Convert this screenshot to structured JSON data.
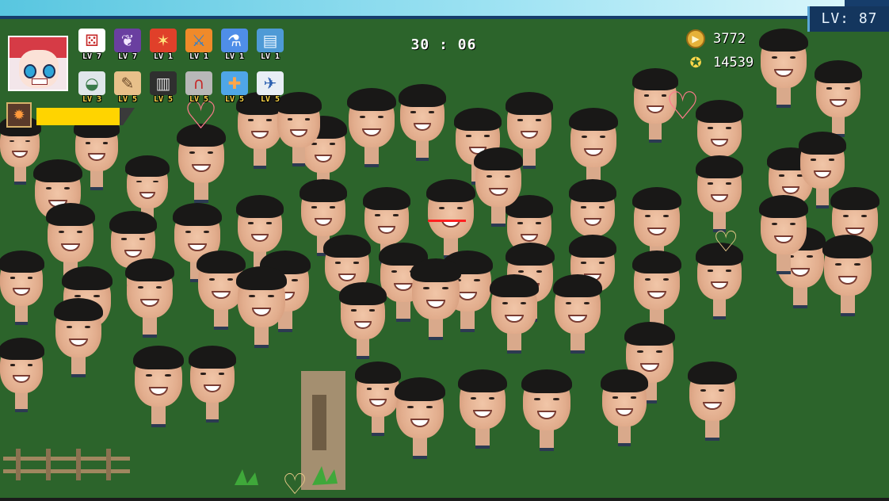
{
  "hud": {
    "level": "LV: 87",
    "experience_fraction": 0.95,
    "timer": "30 : 06",
    "gold": "3772",
    "kills": "14539",
    "special_charge_fraction": 0.85
  },
  "weapons": [
    {
      "icon": "dice-icon",
      "glyph": "⚄",
      "bg": "#ffffff",
      "color": "#c62828",
      "level": "LV 7"
    },
    {
      "icon": "grapes-icon",
      "glyph": "❦",
      "bg": "#6a3fa0",
      "color": "#f2e6ff",
      "level": "LV 7"
    },
    {
      "icon": "fire-slash-icon",
      "glyph": "✶",
      "bg": "#e0402a",
      "color": "#ffe27a",
      "level": "LV 1"
    },
    {
      "icon": "crossed-swords-icon",
      "glyph": "⚔",
      "bg": "#f08a2a",
      "color": "#2a7fd0",
      "level": "LV 1"
    },
    {
      "icon": "pill-bottle-icon",
      "glyph": "⚗",
      "bg": "#4f8ee8",
      "color": "#ffffff",
      "level": "LV 1"
    },
    {
      "icon": "keyboard-icon",
      "glyph": "▤",
      "bg": "#4e9ad6",
      "color": "#e8f4ff",
      "level": "LV 1"
    }
  ],
  "passives": [
    {
      "icon": "rice-bowl-icon",
      "glyph": "◒",
      "bg": "#dfe6ea",
      "color": "#3a7a4a",
      "level": "LV 3"
    },
    {
      "icon": "key-icon",
      "glyph": "✎",
      "bg": "#e8c08a",
      "color": "#6b4a2a",
      "level": "LV 5"
    },
    {
      "icon": "book-icon",
      "glyph": "▥",
      "bg": "#2f2f2f",
      "color": "#d8d8d8",
      "level": "LV 5"
    },
    {
      "icon": "magnet-icon",
      "glyph": "∩",
      "bg": "#b8b8b8",
      "color": "#c62828",
      "level": "LV 5"
    },
    {
      "icon": "syringe-icon",
      "glyph": "✚",
      "bg": "#4fa6e8",
      "color": "#ffa64a",
      "level": "LV 5"
    },
    {
      "icon": "wing-boots-icon",
      "glyph": "✈",
      "bg": "#e8eef5",
      "color": "#2a5fb0",
      "level": "LV 5"
    }
  ],
  "colors": {
    "grass": "#2f6b2c",
    "grass_dark": "#27592a",
    "path": "#a48f70",
    "xp_bar": "#7fd6ec",
    "special_bar": "#ffd400"
  }
}
